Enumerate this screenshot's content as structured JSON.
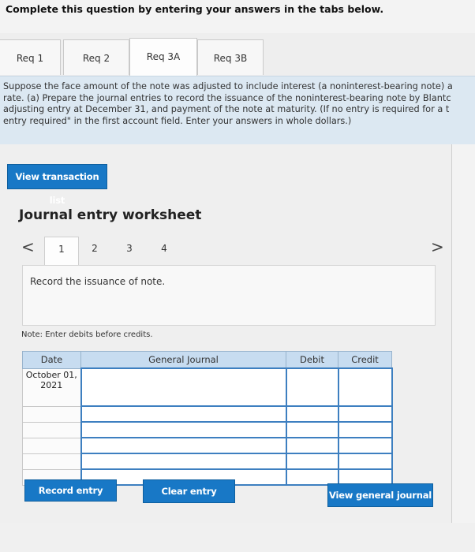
{
  "header": {
    "title": "Complete this question by entering your answers in the tabs below."
  },
  "tabs": [
    {
      "label": "Req 1",
      "active": false
    },
    {
      "label": "Req 2",
      "active": false
    },
    {
      "label": "Req 3A",
      "active": true
    },
    {
      "label": "Req 3B",
      "active": false
    }
  ],
  "instructions": "Suppose the face amount of the note was adjusted to include interest (a noninterest-bearing note) a\nrate. (a) Prepare the journal entries to record the issuance of the noninterest-bearing note by Blantc\nadjusting entry at December 31, and payment of the note at maturity. (If no entry is required for a t\nentry required\" in the first account field. Enter your answers in whole dollars.)",
  "buttons": {
    "view_transaction_list": "View transaction list",
    "record_entry": "Record entry",
    "clear_entry": "Clear entry",
    "view_general_journal": "View general journal"
  },
  "worksheet": {
    "title": "Journal entry worksheet",
    "steps": [
      "1",
      "2",
      "3",
      "4"
    ],
    "active_step": 1,
    "prev_icon": "<",
    "next_icon": ">",
    "instruction": "Record the issuance of note.",
    "note": "Note: Enter debits before credits."
  },
  "journal_table": {
    "headers": {
      "date": "Date",
      "general_journal": "General Journal",
      "debit": "Debit",
      "credit": "Credit"
    },
    "date_value": "October 01,\n2021",
    "rows": [
      {
        "account": "",
        "debit": "",
        "credit": ""
      },
      {
        "account": "",
        "debit": "",
        "credit": ""
      },
      {
        "account": "",
        "debit": "",
        "credit": ""
      },
      {
        "account": "",
        "debit": "",
        "credit": ""
      },
      {
        "account": "",
        "debit": "",
        "credit": ""
      },
      {
        "account": "",
        "debit": "",
        "credit": ""
      }
    ]
  },
  "colors": {
    "accent": "#1878c6",
    "table_header": "#c7dcf0",
    "instructions_bg": "#dce8f2"
  }
}
